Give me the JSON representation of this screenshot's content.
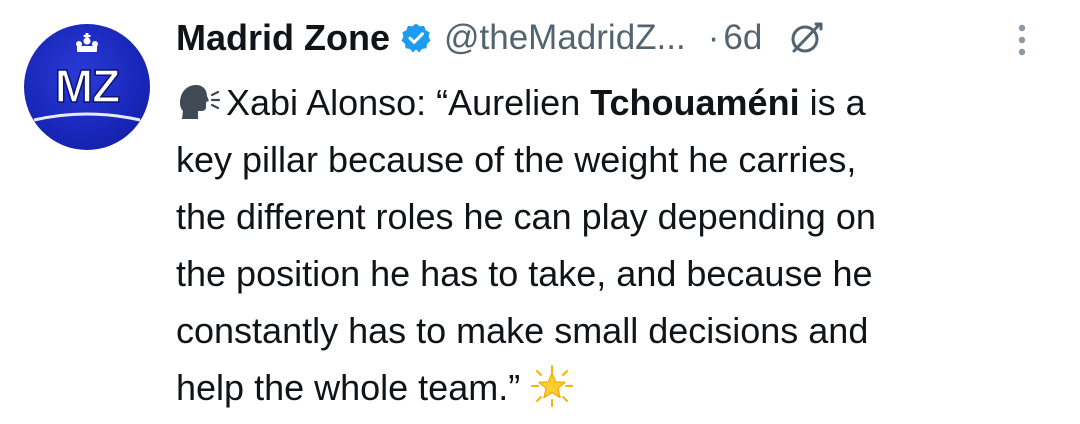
{
  "author": {
    "display_name": "Madrid Zone",
    "handle": "@theMadridZ...",
    "separator": "·",
    "time": "6d",
    "avatar_text": "MZ",
    "verified_icon": "verified-badge-icon",
    "verified_color": "#1d9bf0"
  },
  "actions": {
    "grok_icon": "grok-icon",
    "more_icon": "more-vertical-icon"
  },
  "tweet": {
    "line1_prefix": "Xabi Alonso: “Aurelien ",
    "line1_bold": "Tchouaméni",
    "line1_suffix": " is a",
    "line2": "key pillar because of the weight he carries,",
    "line3": "the different roles he can play depending on",
    "line4": "the position he has to take, and because he",
    "line5": "constantly has to make small decisions and",
    "line6": "help the whole team.”",
    "leading_emoji": "speaking-head-icon",
    "trailing_emoji": "glowing-star-icon"
  },
  "colors": {
    "text": "#0f1419",
    "secondary": "#536471",
    "avatar_bg": "#1826b8"
  }
}
